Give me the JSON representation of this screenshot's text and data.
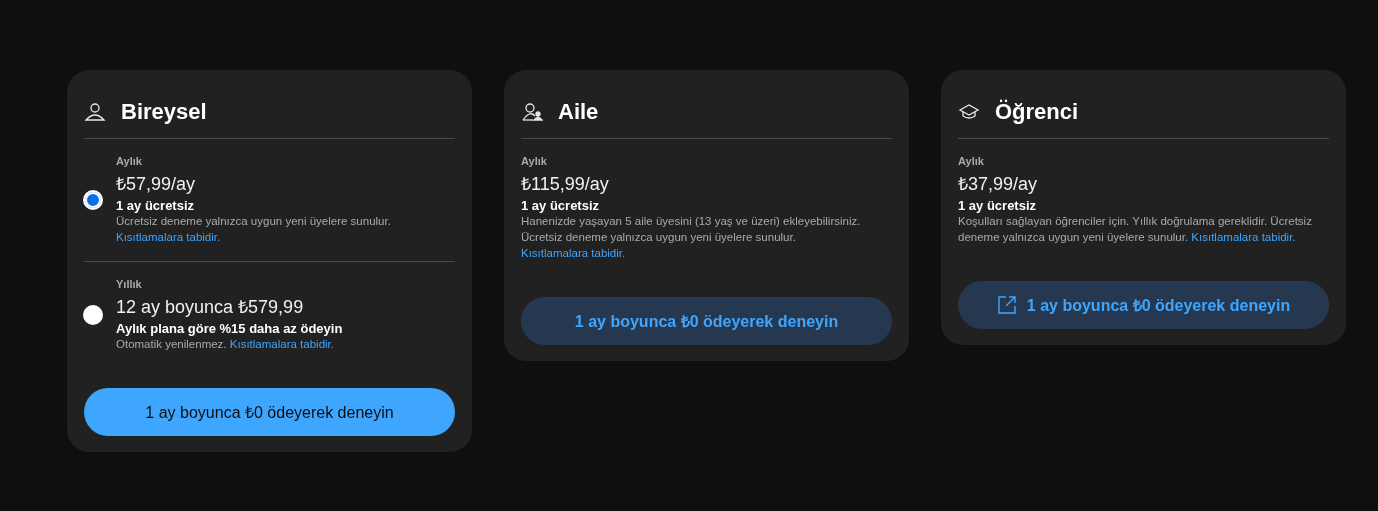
{
  "plans": [
    {
      "kind": "person",
      "title": "Bireysel",
      "options": [
        {
          "selected": true,
          "period": "Aylık",
          "price": "₺57,99/ay",
          "headline": "1 ay ücretsiz",
          "note": "Ücretsiz deneme yalnızca uygun yeni üyelere sunulur.",
          "link": "Kısıtlamalara tabidir."
        },
        {
          "selected": false,
          "period": "Yıllık",
          "price": "12 ay boyunca ₺579,99",
          "headline": "Aylık plana göre %15 daha az ödeyin",
          "note": "Otomatik yenilenmez.",
          "link": "Kısıtlamalara tabidir."
        }
      ],
      "button": {
        "kind": "primary",
        "external": false,
        "label": "1 ay boyunca ₺0 ödeyerek deneyin"
      }
    },
    {
      "kind": "family",
      "title": "Aile",
      "options": [
        {
          "period": "Aylık",
          "price": "₺115,99/ay",
          "headline": "1 ay ücretsiz",
          "note": "Hanenizde yaşayan 5 aile üyesini (13 yaş ve üzeri) ekleyebilirsiniz. Ücretsiz deneme yalnızca uygun yeni üyelere sunulur.",
          "link": "Kısıtlamalara tabidir."
        }
      ],
      "button": {
        "kind": "tonal",
        "external": false,
        "label": "1 ay boyunca ₺0 ödeyerek deneyin"
      }
    },
    {
      "kind": "student",
      "title": "Öğrenci",
      "options": [
        {
          "period": "Aylık",
          "price": "₺37,99/ay",
          "headline": "1 ay ücretsiz",
          "note": "Koşulları sağlayan öğrenciler için. Yıllık doğrulama gereklidir. Ücretsiz deneme yalnızca uygun yeni üyelere sunulur.",
          "link": "Kısıtlamalara tabidir."
        }
      ],
      "button": {
        "kind": "tonal",
        "external": true,
        "label": "1 ay boyunca ₺0 ödeyerek deneyin"
      }
    }
  ]
}
